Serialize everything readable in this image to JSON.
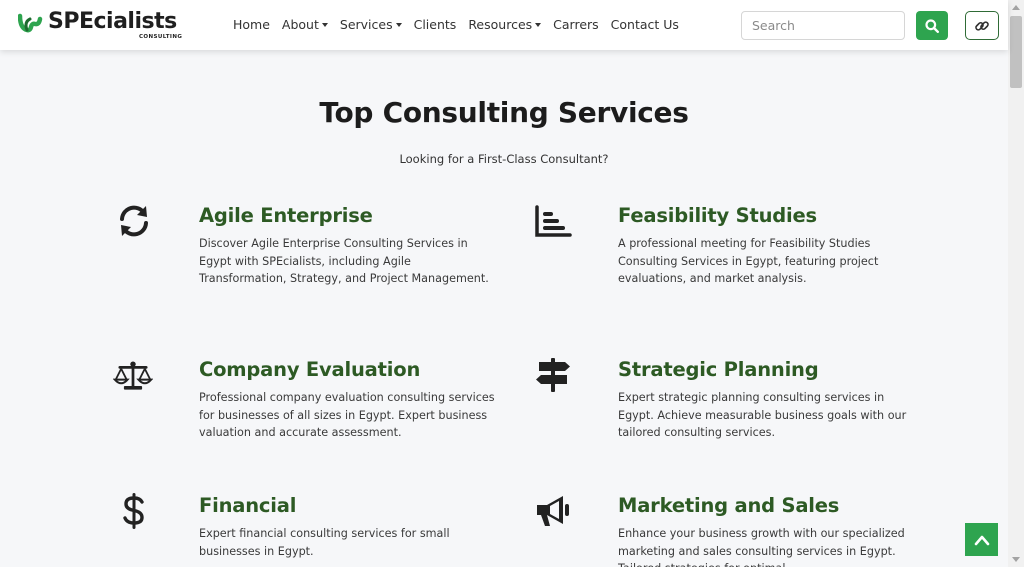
{
  "brand": {
    "name": "SPEcialists",
    "tagline": "CONSULTING",
    "primary_color": "#2ea44f",
    "title_color": "#2d5a24"
  },
  "nav": {
    "items": [
      {
        "label": "Home",
        "dropdown": false
      },
      {
        "label": "About",
        "dropdown": true
      },
      {
        "label": "Services",
        "dropdown": true
      },
      {
        "label": "Clients",
        "dropdown": false
      },
      {
        "label": "Resources",
        "dropdown": true
      },
      {
        "label": "Carrers",
        "dropdown": false
      },
      {
        "label": "Contact Us",
        "dropdown": false
      }
    ],
    "search_placeholder": "Search",
    "search_icon": "search-icon",
    "link_icon": "link-icon"
  },
  "main": {
    "title": "Top Consulting Services",
    "subtitle": "Looking for a First-Class Consultant?"
  },
  "services": [
    {
      "icon": "sync-icon",
      "title": "Agile Enterprise",
      "description": "Discover Agile Enterprise Consulting Services in Egypt with SPEcialists, including Agile Transformation, Strategy, and Project Management."
    },
    {
      "icon": "bar-chart-icon",
      "title": "Feasibility Studies",
      "description": "A professional meeting for Feasibility Studies Consulting Services in Egypt, featuring project evaluations, and market analysis."
    },
    {
      "icon": "balance-scale-icon",
      "title": "Company Evaluation",
      "description": "Professional company evaluation consulting services for businesses of all sizes in Egypt. Expert business valuation and accurate assessment."
    },
    {
      "icon": "signpost-icon",
      "title": "Strategic Planning",
      "description": "Expert strategic planning consulting services in Egypt. Achieve measurable business goals with our tailored consulting services."
    },
    {
      "icon": "dollar-icon",
      "title": "Financial",
      "description": "Expert financial consulting services for small businesses in Egypt."
    },
    {
      "icon": "megaphone-icon",
      "title": "Marketing and Sales",
      "description": "Enhance your business growth with our specialized marketing and sales consulting services in Egypt. Tailored strategies for optimal"
    }
  ],
  "back_to_top_icon": "chevron-up-icon"
}
